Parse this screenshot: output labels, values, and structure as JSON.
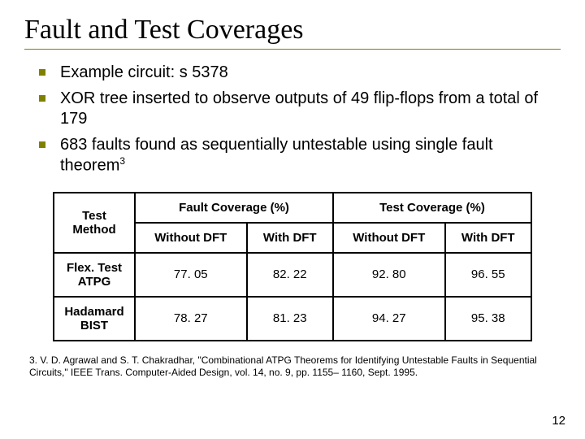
{
  "title": "Fault and Test Coverages",
  "bullets": [
    "Example circuit: s 5378",
    "XOR tree inserted to observe outputs of 49 flip-flops from a total of 179",
    "683 faults found as sequentially untestable using single fault theorem"
  ],
  "bullet3_sup": "3",
  "table": {
    "head": {
      "method": "Test Method",
      "group1": "Fault Coverage (%)",
      "group2": "Test Coverage (%)",
      "sub": [
        "Without DFT",
        "With DFT",
        "Without DFT",
        "With DFT"
      ]
    },
    "rows": [
      {
        "name": "Flex. Test ATPG",
        "vals": [
          "77. 05",
          "82. 22",
          "92. 80",
          "96. 55"
        ]
      },
      {
        "name": "Hadamard BIST",
        "vals": [
          "78. 27",
          "81. 23",
          "94. 27",
          "95. 38"
        ]
      }
    ]
  },
  "footnote": "3. V. D. Agrawal and S. T. Chakradhar, \"Combinational ATPG Theorems for Identifying Untestable Faults in Sequential Circuits,\" IEEE Trans. Computer-Aided Design, vol. 14, no. 9, pp. 1155– 1160, Sept. 1995.",
  "pagenum": "12",
  "chart_data": {
    "type": "table",
    "title": "Fault and Test Coverages",
    "columns": [
      "Test Method",
      "Fault Coverage (%) Without DFT",
      "Fault Coverage (%) With DFT",
      "Test Coverage (%) Without DFT",
      "Test Coverage (%) With DFT"
    ],
    "rows": [
      [
        "Flex. Test ATPG",
        77.05,
        82.22,
        92.8,
        96.55
      ],
      [
        "Hadamard BIST",
        78.27,
        81.23,
        94.27,
        95.38
      ]
    ]
  }
}
